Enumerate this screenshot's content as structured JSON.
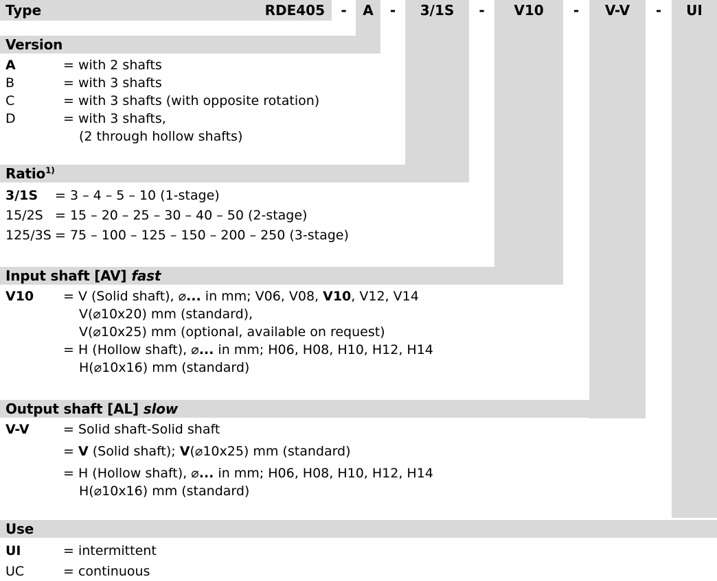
{
  "colors": {
    "band_gray": "#d9d9d9",
    "text": "#000000",
    "page_bg": "#ffffff"
  },
  "type_row": {
    "label": "Type",
    "code": "RDE405",
    "separator": "-",
    "segments": [
      {
        "name": "version",
        "value": "A"
      },
      {
        "name": "ratio",
        "value": "3/1S"
      },
      {
        "name": "input-shaft",
        "value": "V10"
      },
      {
        "name": "output-shaft",
        "value": "V-V"
      },
      {
        "name": "use",
        "value": "UI"
      }
    ]
  },
  "sections": [
    {
      "id": "version",
      "title": "Version",
      "title_suffix": "",
      "title_italic": "",
      "rows": [
        {
          "key": "A",
          "key_bold": true,
          "value": "= with 2 shafts"
        },
        {
          "key": "B",
          "key_bold": false,
          "value": "= with 3 shafts"
        },
        {
          "key": "C",
          "key_bold": false,
          "value": "= with 3 shafts (with opposite rotation)"
        },
        {
          "key": "D",
          "key_bold": false,
          "value": "= with 3 shafts,"
        },
        {
          "key": "",
          "key_bold": false,
          "value": "(2 through hollow shafts)"
        }
      ]
    },
    {
      "id": "ratio",
      "title": "Ratio",
      "title_suffix": "1)",
      "title_italic": "",
      "rows": [
        {
          "key": "3/1S",
          "key_bold": true,
          "value": "= 3 – 4 – 5 – 10 (1-stage)"
        },
        {
          "key": "15/2S",
          "key_bold": false,
          "value": "= 15 – 20 – 25 – 30 – 40 – 50 (2-stage)"
        },
        {
          "key": "125/3S",
          "key_bold": false,
          "value": "= 75 – 100 – 125 – 150 – 200 – 250 (3-stage)"
        }
      ]
    },
    {
      "id": "input-shaft",
      "title": "Input shaft [AV]",
      "title_suffix": "",
      "title_italic": "fast",
      "rows": [
        {
          "key": "V10",
          "key_bold": true,
          "value": "= V (Solid shaft), ⌀... in mm; V06, V08, V10, V12, V14"
        },
        {
          "key": "",
          "key_bold": false,
          "value": "V(⌀10x20) mm (standard),"
        },
        {
          "key": "",
          "key_bold": false,
          "value": "V(⌀10x25) mm (optional, available on request)"
        },
        {
          "key": "",
          "key_bold": false,
          "value": "= H (Hollow shaft), ⌀... in mm; H06, H08, H10, H12, H14"
        },
        {
          "key": "",
          "key_bold": false,
          "value": "H(⌀10x16) mm (standard)"
        }
      ]
    },
    {
      "id": "output-shaft",
      "title": "Output shaft [AL]",
      "title_suffix": "",
      "title_italic": "slow",
      "rows": [
        {
          "key": "V-V",
          "key_bold": true,
          "value": "= Solid shaft-Solid shaft"
        },
        {
          "key": "",
          "key_bold": false,
          "value": "= V (Solid shaft); V(⌀10x25) mm (standard)"
        },
        {
          "key": "",
          "key_bold": false,
          "value": "= H (Hollow shaft), ⌀... in mm; H06, H08, H10, H12, H14"
        },
        {
          "key": "",
          "key_bold": false,
          "value": "H(⌀10x16) mm (standard)"
        }
      ]
    },
    {
      "id": "use",
      "title": "Use",
      "title_suffix": "",
      "title_italic": "",
      "rows": [
        {
          "key": "UI",
          "key_bold": true,
          "value": "= intermittent"
        },
        {
          "key": "UC",
          "key_bold": false,
          "value": "= continuous"
        }
      ]
    }
  ]
}
